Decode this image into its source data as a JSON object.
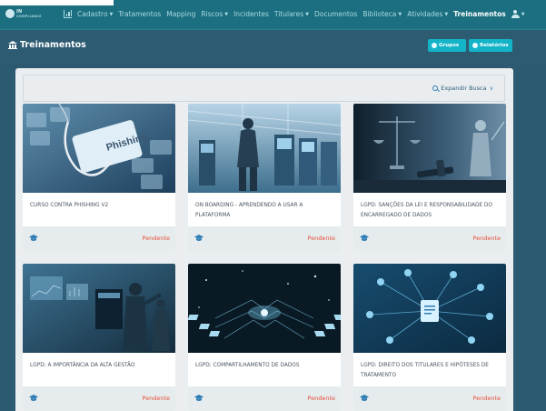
{
  "nav": {
    "logo_text": "IN",
    "logo_sub": "COMPLIANCE",
    "items": [
      {
        "label": "Cadastro",
        "caret": true
      },
      {
        "label": "Tratamentos",
        "caret": false
      },
      {
        "label": "Mapping",
        "caret": false
      },
      {
        "label": "Riscos",
        "caret": true
      },
      {
        "label": "Incidentes",
        "caret": false
      },
      {
        "label": "Titulares",
        "caret": true
      },
      {
        "label": "Documentos",
        "caret": false
      },
      {
        "label": "Biblioteca",
        "caret": true
      },
      {
        "label": "Atividades",
        "caret": true
      },
      {
        "label": "Treinamentos",
        "caret": false,
        "active": true
      }
    ],
    "caret_glyph": "▼",
    "icons": {
      "dashboard": "chart-icon",
      "user": "user-icon"
    }
  },
  "header": {
    "title": "Treinamentos",
    "buttons": {
      "grupos": "Grupos",
      "relatorios": "Relatórios"
    }
  },
  "search": {
    "expand_label": "Expandir Busca",
    "chevron": "∨"
  },
  "courses": [
    {
      "title": "CURSO CONTRA PHISHING V2",
      "status": "Pendente",
      "image": "phishing-keyboard-image"
    },
    {
      "title": "ON BOARDING - APRENDENDO A USAR A PLATAFORMA",
      "status": "Pendente",
      "image": "airport-kiosk-image"
    },
    {
      "title": "LGPD: SANÇÕES DA LEI E RESPONSABILIDADE DO ENCARREGADO DE DADOS",
      "status": "Pendente",
      "image": "justice-gavel-image"
    },
    {
      "title": "LGPD: A IMPORTÂNCIA DA ALTA GESTÃO",
      "status": "Pendente",
      "image": "business-presentation-image"
    },
    {
      "title": "LGPD: COMPARTILHAMENTO DE DADOS",
      "status": "Pendente",
      "image": "data-network-image"
    },
    {
      "title": "LGPD: DIREITO DOS TITULARES E HIPÓTESES DE TRATAMENTO",
      "status": "Pendente",
      "image": "people-network-image"
    }
  ],
  "colors": {
    "navbar": "#1b6f80",
    "header": "#2d5b72",
    "accent_button": "#13b4c8",
    "status_pending": "#e8523c",
    "icon_blue": "#2e7db5"
  }
}
